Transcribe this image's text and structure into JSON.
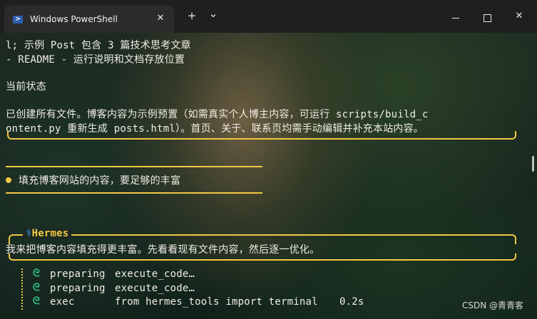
{
  "window": {
    "tab_title": "Windows PowerShell",
    "tab_close_glyph": "✕",
    "new_tab_glyph": "+",
    "dropdown_glyph": "⌄",
    "close_glyph": "✕"
  },
  "terminal": {
    "lines": [
      "l; 示例 Post 包含 3 篇技术思考文章",
      "- README - 运行说明和文档存放位置",
      "当前状态",
      "已创建所有文件。博客内容为示例预置（如需真实个人博主内容，可运行 scripts/build_c",
      "ontent.py 重新生成 posts.html）。首页、关于、联系页均需手动编辑并补充本站内容。"
    ],
    "user_prompt": "填充博客网站的内容，要足够的丰富",
    "hermes_label": "Hermes",
    "hermes_icon_glyph": "⚕",
    "hermes_reply": "我来把博客内容填充得更丰富。先看看现有文件内容，然后逐一优化。",
    "tool_calls": [
      {
        "action": "preparing",
        "detail": "execute_code…",
        "time": ""
      },
      {
        "action": "preparing",
        "detail": "execute_code…",
        "time": ""
      },
      {
        "action": "exec",
        "detail": "from hermes_tools import terminal",
        "time": "0.2s"
      }
    ],
    "tool_icon_glyph": "ᘓ"
  },
  "watermark": "CSDN @青青客",
  "colors": {
    "accent": "#f2c744",
    "tool_green": "#2fc48a",
    "text": "#f0ede4",
    "titlebar": "#1f1f1f"
  }
}
